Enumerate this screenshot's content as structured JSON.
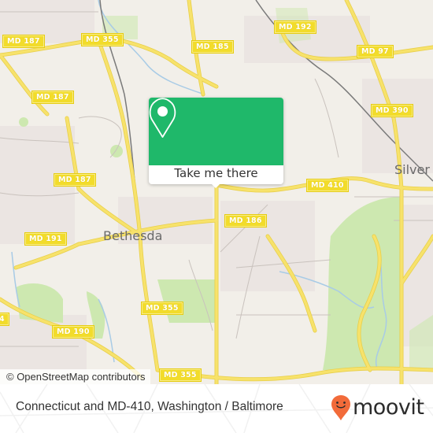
{
  "map": {
    "attribution": "© OpenStreetMap contributors",
    "colors": {
      "land": "#f2efe9",
      "park": "#cde8b0",
      "road": "#f7e26b",
      "road_outline": "#e8cf4a",
      "water": "#a8cbe6",
      "rail": "#7a7a7a",
      "residential": "#ebe5e2"
    },
    "places": [
      {
        "name": "Bethesda"
      },
      {
        "name": "Silver"
      }
    ],
    "shields": [
      {
        "label": "MD 187"
      },
      {
        "label": "MD 355"
      },
      {
        "label": "MD 185"
      },
      {
        "label": "MD 192"
      },
      {
        "label": "MD 97"
      },
      {
        "label": "MD 187"
      },
      {
        "label": "MD 390"
      },
      {
        "label": "MD 187"
      },
      {
        "label": "MD 410"
      },
      {
        "label": "MD 186"
      },
      {
        "label": "MD 191"
      },
      {
        "label": "MD 355"
      },
      {
        "label": "MD 190"
      },
      {
        "label": "MD 355"
      },
      {
        "label": "4"
      }
    ]
  },
  "card": {
    "button_label": "Take me there",
    "icon": "location-pin-icon",
    "color": "#1fb86a"
  },
  "footer": {
    "title": "Connecticut and MD-410, Washington / Baltimore",
    "brand": "moovit",
    "brand_color": "#f26b3a"
  }
}
